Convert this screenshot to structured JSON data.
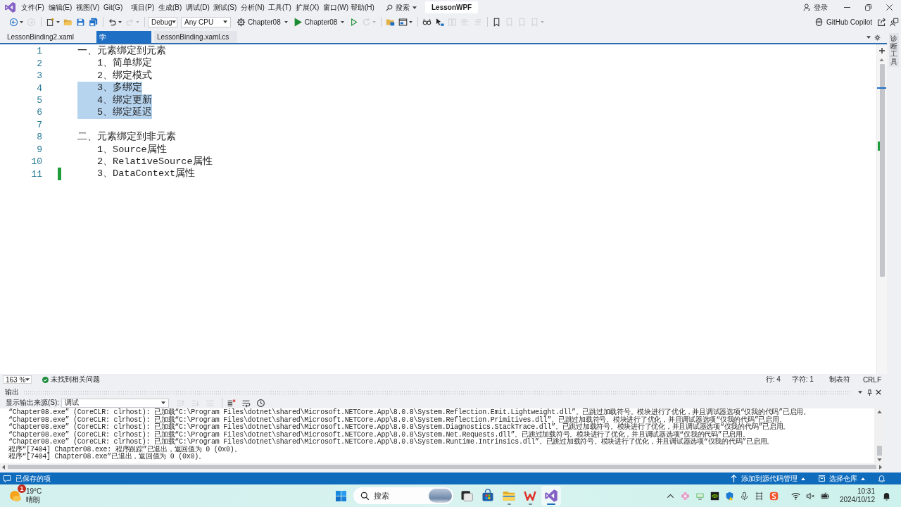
{
  "menu_bar": {
    "items": [
      "文件(F)",
      "编辑(E)",
      "视图(V)",
      "Git(G)",
      "项目(P)",
      "生成(B)",
      "调试(D)",
      "测试(S)",
      "分析(N)",
      "工具(T)",
      "扩展(X)",
      "窗口(W)",
      "帮助(H)"
    ],
    "search": "搜索",
    "solution_name": "LessonWPF",
    "sign_in": "登录"
  },
  "toolbar": {
    "left_buttons": [
      {
        "kind": "back",
        "disabled": false,
        "dropdown": true
      },
      {
        "kind": "forward",
        "disabled": true,
        "dropdown": false
      },
      {
        "kind": "new-item",
        "disabled": false,
        "dropdown": true
      },
      {
        "kind": "open",
        "disabled": false,
        "dropdown": false
      },
      {
        "kind": "save",
        "disabled": false,
        "dropdown": false
      },
      {
        "kind": "save-all",
        "disabled": false,
        "dropdown": false
      },
      {
        "kind": "undo",
        "disabled": false,
        "dropdown": true
      },
      {
        "kind": "redo",
        "disabled": true,
        "dropdown": true
      }
    ],
    "configuration": "Debug",
    "platform": "Any CPU",
    "startup_project": "Chapter08",
    "run_target": "Chapter08",
    "right_buttons": [
      {
        "kind": "run-without-debugging",
        "disabled": false,
        "dropdown": false
      },
      {
        "kind": "hot-reload",
        "disabled": true,
        "dropdown": true
      },
      {
        "kind": "browse-folder",
        "disabled": false,
        "dropdown": false
      },
      {
        "kind": "window-layout",
        "disabled": false,
        "dropdown": true
      },
      {
        "kind": "glasses",
        "disabled": false,
        "dropdown": false
      },
      {
        "kind": "select-element",
        "disabled": false,
        "dropdown": false
      },
      {
        "kind": "columns",
        "disabled": true,
        "dropdown": false
      },
      {
        "kind": "comment",
        "disabled": true,
        "dropdown": false
      },
      {
        "kind": "uncomment",
        "disabled": true,
        "dropdown": false
      },
      {
        "kind": "bookmark",
        "disabled": false,
        "dropdown": false
      },
      {
        "kind": "bookmark",
        "disabled": true,
        "dropdown": false
      },
      {
        "kind": "bookmark",
        "disabled": true,
        "dropdown": false
      },
      {
        "kind": "bookmark",
        "disabled": true,
        "dropdown": true
      }
    ],
    "copilot": "GitHub Copilot"
  },
  "document_tabs": [
    {
      "label": "LessonBinding2.xaml",
      "selected": false
    },
    {
      "label": "学",
      "selected": true
    },
    {
      "label": "LessonBinding.xaml.cs",
      "selected": false
    }
  ],
  "tool_window_tabs": [
    "诊断工具"
  ],
  "editor": {
    "lines": [
      {
        "number": "1",
        "text": "一、元素绑定到元素",
        "selected": false,
        "changed": false,
        "children": [
          {
            "number": "2",
            "text": "1、简单绑定",
            "selected": false,
            "changed": false
          },
          {
            "number": "3",
            "text": "2、绑定模式",
            "selected": false,
            "changed": false
          },
          {
            "number": "4",
            "text": "3、多绑定",
            "selected": true,
            "changed": false
          },
          {
            "number": "5",
            "text": "4、绑定更新",
            "selected": true,
            "changed": false
          },
          {
            "number": "6",
            "text": "5、绑定延迟",
            "selected": true,
            "changed": false
          }
        ]
      },
      {
        "number": "7",
        "selected": false,
        "changed": false
      },
      {
        "number": "8",
        "text": "二、元素绑定到非元素",
        "selected": false,
        "changed": false,
        "children": [
          {
            "number": "9",
            "text": "1、Source属性",
            "selected": false,
            "changed": false
          },
          {
            "number": "10",
            "text": "2、RelativeSource属性",
            "selected": false,
            "changed": false
          },
          {
            "number": "11",
            "text": "3、DataContext属性",
            "selected": false,
            "changed": true
          }
        ]
      }
    ]
  },
  "editor_status": {
    "zoom": "163 %",
    "issues": "未找到相关问题",
    "line": "行: 4",
    "column": "字符: 1",
    "indentation": "制表符",
    "line_ending": "CRLF"
  },
  "output_panel": {
    "title": "输出",
    "source_label": "显示输出来源(S):",
    "source": "调试",
    "buttons": [
      {
        "kind": "prev-message",
        "disabled": true
      },
      {
        "kind": "next-message",
        "disabled": true
      },
      {
        "kind": "find-message",
        "disabled": true
      },
      {
        "kind": "clear-all",
        "disabled": false
      },
      {
        "kind": "word-wrap",
        "disabled": false
      },
      {
        "kind": "timestamp",
        "disabled": false
      }
    ],
    "lines": [
      "“Chapter08.exe” (CoreCLR: clrhost): 已加载“C:\\Program Files\\dotnet\\shared\\Microsoft.NETCore.App\\8.0.8\\System.Reflection.Emit.Lightweight.dll”。已跳过加载符号。模块进行了优化，并且调试器选项“仅我的代码”已启用。",
      "“Chapter08.exe” (CoreCLR: clrhost): 已加载“C:\\Program Files\\dotnet\\shared\\Microsoft.NETCore.App\\8.0.8\\System.Reflection.Primitives.dll”。已跳过加载符号。模块进行了优化，并且调试器选项“仅我的代码”已启用。",
      "“Chapter08.exe” (CoreCLR: clrhost): 已加载“C:\\Program Files\\dotnet\\shared\\Microsoft.NETCore.App\\8.0.8\\System.Diagnostics.StackTrace.dll”。已跳过加载符号。模块进行了优化，并且调试器选项“仅我的代码”已启用。",
      "“Chapter08.exe” (CoreCLR: clrhost): 已加载“C:\\Program Files\\dotnet\\shared\\Microsoft.NETCore.App\\8.0.8\\System.Net.Requests.dll”。已跳过加载符号。模块进行了优化，并且调试器选项“仅我的代码”已启用。",
      "“Chapter08.exe” (CoreCLR: clrhost): 已加载“C:\\Program Files\\dotnet\\shared\\Microsoft.NETCore.App\\8.0.8\\System.Runtime.Intrinsics.dll”。已跳过加载符号。模块进行了优化，并且调试器选项“仅我的代码”已启用。",
      "程序“[7404] Chapter08.exe: 程序跟踪”已退出，返回值为 0 (0x0)。",
      "程序“[7404] Chapter08.exe”已退出，返回值为 0 (0x0)。"
    ]
  },
  "status_bar": {
    "message": "已保存的项",
    "source_control": "添加到源代码管理",
    "repository": "选择仓库"
  },
  "taskbar": {
    "weather": {
      "badge": "1",
      "temperature": "19°C",
      "condition": "晴朗"
    },
    "search": {
      "placeholder": "搜索"
    },
    "apps": [
      {
        "kind": "task-view",
        "running": false,
        "selected": false
      },
      {
        "kind": "store",
        "running": false,
        "selected": false
      },
      {
        "kind": "file-explorer",
        "running": true,
        "selected": false
      },
      {
        "kind": "wps",
        "running": true,
        "selected": false
      },
      {
        "kind": "visual-studio",
        "running": true,
        "selected": true
      }
    ],
    "clock": {
      "time": "10:31",
      "date": "2024/10/12"
    }
  }
}
